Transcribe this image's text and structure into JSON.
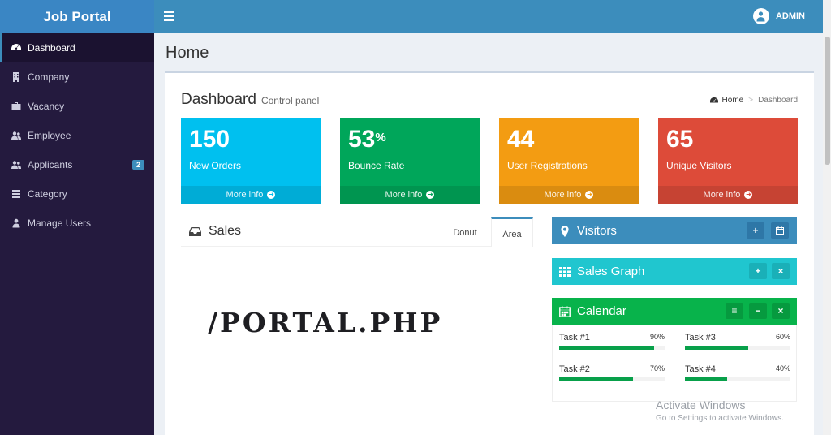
{
  "app": {
    "name": "Job Portal"
  },
  "sidebar": {
    "items": [
      {
        "label": "Dashboard",
        "icon": "dashboard-icon"
      },
      {
        "label": "Company",
        "icon": "building-icon"
      },
      {
        "label": "Vacancy",
        "icon": "briefcase-icon"
      },
      {
        "label": "Employee",
        "icon": "users-icon"
      },
      {
        "label": "Applicants",
        "icon": "users-icon",
        "badge": "2"
      },
      {
        "label": "Category",
        "icon": "list-icon"
      },
      {
        "label": "Manage Users",
        "icon": "user-icon"
      }
    ]
  },
  "header": {
    "user": "ADMIN"
  },
  "page": {
    "title": "Home"
  },
  "dashboard": {
    "title": "Dashboard",
    "subtitle": "Control panel",
    "breadcrumb": [
      "Home",
      "Dashboard"
    ]
  },
  "stats": [
    {
      "value": "150",
      "suffix": "",
      "label": "New Orders",
      "more": "More info",
      "color": "#00c0ef"
    },
    {
      "value": "53",
      "suffix": "%",
      "label": "Bounce Rate",
      "more": "More info",
      "color": "#00a65a"
    },
    {
      "value": "44",
      "suffix": "",
      "label": "User Registrations",
      "more": "More info",
      "color": "#f39c12"
    },
    {
      "value": "65",
      "suffix": "",
      "label": "Unique Visitors",
      "more": "More info",
      "color": "#dd4b39"
    }
  ],
  "sales": {
    "title": "Sales",
    "tabs": [
      "Donut",
      "Area"
    ],
    "active_tab": "Area",
    "overlay_text": "/PORTAL.PHP"
  },
  "widgets": {
    "visitors": {
      "title": "Visitors",
      "tools": [
        "+",
        "calendar"
      ]
    },
    "sales_graph": {
      "title": "Sales Graph",
      "tools": [
        "+",
        "×"
      ]
    },
    "calendar": {
      "title": "Calendar",
      "tools": [
        "≡",
        "−",
        "×"
      ]
    }
  },
  "tasks": [
    {
      "name": "Task #1",
      "percent": "90%",
      "value": 90
    },
    {
      "name": "Task #3",
      "percent": "60%",
      "value": 60
    },
    {
      "name": "Task #2",
      "percent": "70%",
      "value": 70
    },
    {
      "name": "Task #4",
      "percent": "40%",
      "value": 40
    }
  ],
  "os_notice": {
    "line1": "Activate Windows",
    "line2": "Go to Settings to activate Windows."
  }
}
